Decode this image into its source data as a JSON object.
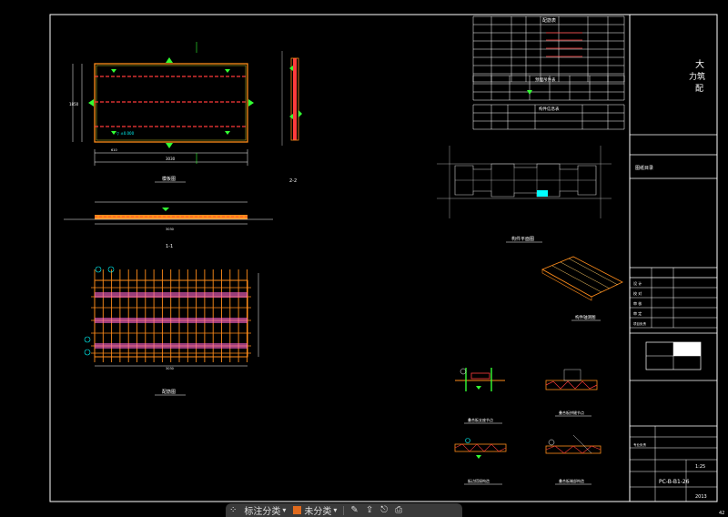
{
  "toolbar": {
    "markup_label": "标注分类",
    "category_label": "未分类",
    "accent": "#e06a1d"
  },
  "drawing": {
    "title_vertical": [
      "大",
      "力筑",
      "配"
    ],
    "view_plan": "模板图",
    "view_section_11": "1-1",
    "view_section_22": "2-2",
    "view_rebar": "配筋图",
    "view_site": "构件平面图",
    "view_3d": "构件轴测图",
    "detail_a": "叠合板支座节点",
    "detail_b": "叠合板拼缝节点",
    "detail_c": "板边搭接构造",
    "detail_d": "叠合板端部构造",
    "dim_width": "3030",
    "dim_height": "1850",
    "dim_610": "610",
    "dim_rebar_width": "3030",
    "dim_sec": "3030",
    "elev": "▽ ±0.000",
    "title_block": {
      "project": "图纸目录",
      "drawing_no": "PC-B-B1-26",
      "scale": "1:25",
      "date": "2013",
      "cells": [
        "设 计",
        "校 对",
        "审 核",
        "审 定",
        "项目负责",
        "专业负责"
      ]
    },
    "tables": {
      "t1_title": "配筋表",
      "t2_title": "预埋吊件表",
      "t3_title": "构件信息表"
    },
    "page_corner": "42"
  },
  "colors": {
    "line": "#ffffff",
    "orange": "#ff8c1a",
    "red": "#ff3b3b",
    "yellow": "#ffff33",
    "green": "#33ff33",
    "cyan": "#00ffff",
    "magenta": "#ff66cc"
  }
}
